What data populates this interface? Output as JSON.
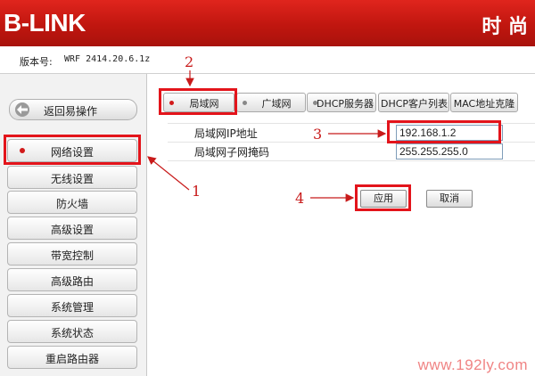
{
  "header": {
    "logo": "B-LINK",
    "right_text": "时 尚"
  },
  "version": {
    "label": "版本号:",
    "value": "WRF 2414.20.6.1z"
  },
  "sidebar": {
    "back_label": "返回易操作",
    "items": [
      {
        "label": "网络设置",
        "active": true
      },
      {
        "label": "无线设置"
      },
      {
        "label": "防火墙"
      },
      {
        "label": "高级设置"
      },
      {
        "label": "带宽控制"
      },
      {
        "label": "高级路由"
      },
      {
        "label": "系统管理"
      },
      {
        "label": "系统状态"
      },
      {
        "label": "重启路由器"
      }
    ]
  },
  "tabs": [
    {
      "label": "局域网",
      "active": true
    },
    {
      "label": "广域网"
    },
    {
      "label": "DHCP服务器"
    },
    {
      "label": "DHCP客户列表"
    },
    {
      "label": "MAC地址克隆"
    }
  ],
  "form": {
    "ip_label": "局域网IP地址",
    "ip_value": "192.168.1.2",
    "mask_label": "局域网子网掩码",
    "mask_value": "255.255.255.0"
  },
  "buttons": {
    "apply": "应用",
    "cancel": "取消"
  },
  "annotations": [
    "1",
    "2",
    "3",
    "4"
  ],
  "watermark": "www.192ly.com",
  "colors": {
    "brand_red": "#c0160f",
    "annotation_red": "#e3141b"
  }
}
